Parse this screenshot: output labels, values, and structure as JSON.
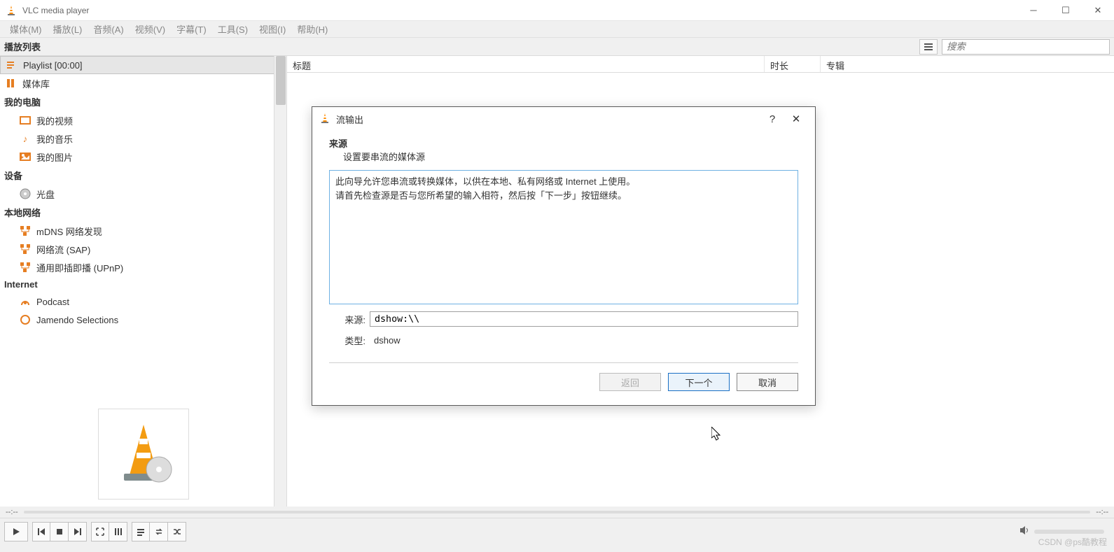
{
  "titlebar": {
    "title": "VLC media player"
  },
  "menu": [
    "媒体(M)",
    "播放(L)",
    "音频(A)",
    "视频(V)",
    "字幕(T)",
    "工具(S)",
    "视图(I)",
    "帮助(H)"
  ],
  "playlist_header": {
    "title": "播放列表",
    "search_placeholder": "搜索"
  },
  "columns": {
    "title": "标题",
    "duration": "时长",
    "album": "专辑"
  },
  "sidebar": {
    "items": [
      {
        "type": "item",
        "icon": "playlist",
        "label": "Playlist [00:00]",
        "selected": true
      },
      {
        "type": "item",
        "icon": "library",
        "label": "媒体库"
      },
      {
        "type": "header",
        "label": "我的电脑"
      },
      {
        "type": "child",
        "icon": "video",
        "label": "我的视频"
      },
      {
        "type": "child",
        "icon": "music",
        "label": "我的音乐"
      },
      {
        "type": "child",
        "icon": "pictures",
        "label": "我的图片"
      },
      {
        "type": "header",
        "label": "设备"
      },
      {
        "type": "child",
        "icon": "disc",
        "label": "光盘"
      },
      {
        "type": "header",
        "label": "本地网络"
      },
      {
        "type": "child",
        "icon": "net",
        "label": "mDNS 网络发现"
      },
      {
        "type": "child",
        "icon": "net",
        "label": "网络流 (SAP)"
      },
      {
        "type": "child",
        "icon": "net",
        "label": "通用即插即播  (UPnP)"
      },
      {
        "type": "header",
        "label": "Internet"
      },
      {
        "type": "child",
        "icon": "podcast",
        "label": "Podcast"
      },
      {
        "type": "child",
        "icon": "jamendo",
        "label": "Jamendo Selections"
      }
    ]
  },
  "dialog": {
    "title": "流输出",
    "section_title": "来源",
    "section_sub": "设置要串流的媒体源",
    "info_line1": "此向导允许您串流或转换媒体，以供在本地、私有网络或 Internet 上使用。",
    "info_line2": "请首先检查源是否与您所希望的输入相符，然后按「下一步」按钮继续。",
    "src_label": "来源:",
    "src_value": "dshow:\\\\",
    "type_label": "类型:",
    "type_value": "dshow",
    "btn_back": "返回",
    "btn_next": "下一个",
    "btn_cancel": "取消"
  },
  "timebar": {
    "left": "--:--",
    "right": "--:--"
  },
  "watermark": "CSDN @ps酷教程"
}
